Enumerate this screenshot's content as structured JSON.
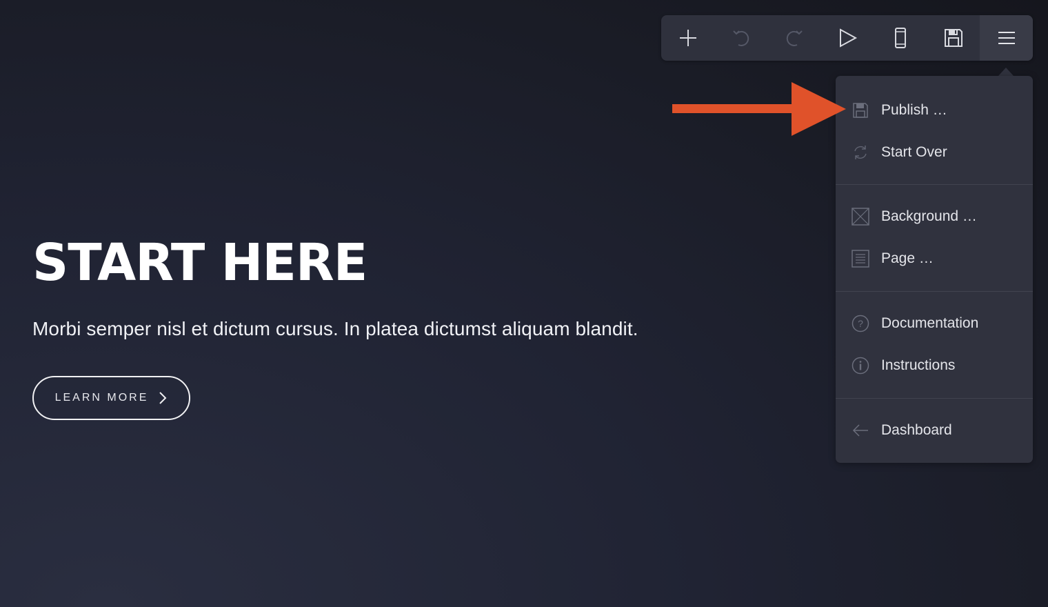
{
  "hero": {
    "title": "START HERE",
    "subtitle": "Morbi semper nisl et dictum cursus. In platea dictumst aliquam blandit.",
    "button_label": "LEARN MORE"
  },
  "toolbar": {
    "buttons": [
      {
        "name": "add",
        "icon": "plus-icon",
        "enabled": true
      },
      {
        "name": "undo",
        "icon": "undo-icon",
        "enabled": false
      },
      {
        "name": "redo",
        "icon": "redo-icon",
        "enabled": false
      },
      {
        "name": "preview",
        "icon": "play-icon",
        "enabled": true
      },
      {
        "name": "mobile-view",
        "icon": "mobile-icon",
        "enabled": true
      },
      {
        "name": "save",
        "icon": "floppy-disk-icon",
        "enabled": true
      },
      {
        "name": "menu",
        "icon": "hamburger-icon",
        "enabled": true,
        "active": true
      }
    ]
  },
  "menu": {
    "groups": [
      {
        "items": [
          {
            "label": "Publish …",
            "icon": "floppy-disk-icon"
          },
          {
            "label": "Start Over",
            "icon": "refresh-icon"
          }
        ]
      },
      {
        "items": [
          {
            "label": "Background …",
            "icon": "image-placeholder-icon"
          },
          {
            "label": "Page …",
            "icon": "page-lines-icon"
          }
        ]
      },
      {
        "items": [
          {
            "label": "Documentation",
            "icon": "question-circle-icon"
          },
          {
            "label": "Instructions",
            "icon": "info-circle-icon"
          }
        ]
      },
      {
        "items": [
          {
            "label": "Dashboard",
            "icon": "arrow-left-icon"
          }
        ]
      }
    ]
  },
  "colors": {
    "annotation_arrow": "#e0522a",
    "toolbar_bg": "#2f313d",
    "menu_bg": "#30323e",
    "icon_enabled": "#d9dae0",
    "icon_disabled": "#555867"
  }
}
